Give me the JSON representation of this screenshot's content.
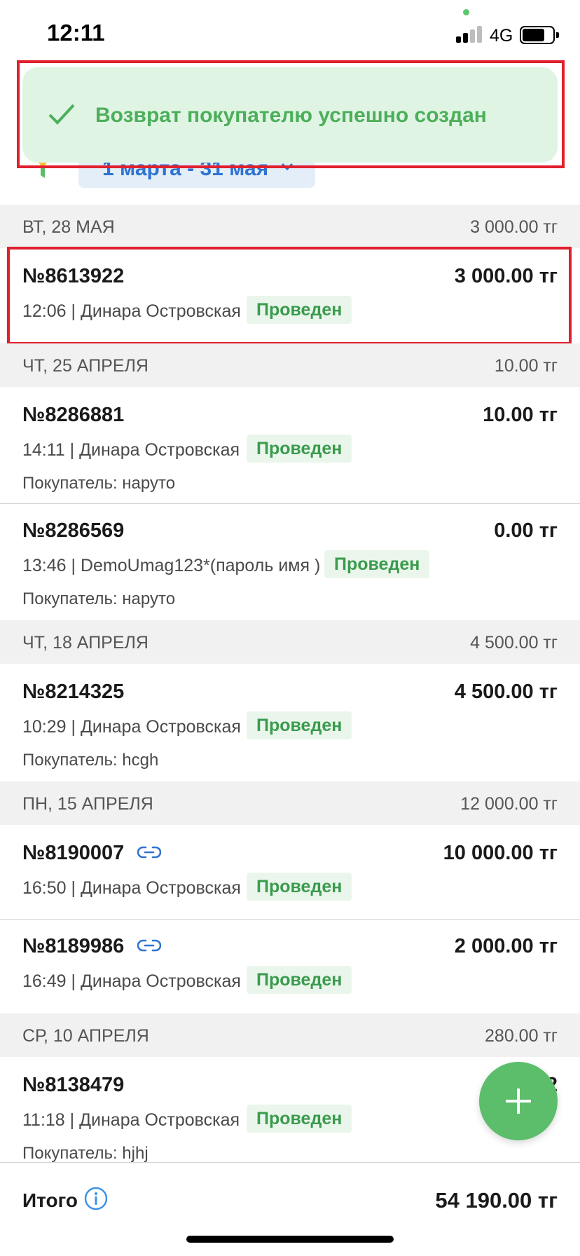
{
  "status_bar": {
    "time": "12:11",
    "network": "4G"
  },
  "toast": {
    "message": "Возврат покупателю успешно создан"
  },
  "filter": {
    "date_range": "1 марта - 31 мая"
  },
  "sections": [
    {
      "day": "ВТ, 28 МАЯ",
      "sum": "3 000.00 тг",
      "records": [
        {
          "number": "№8613922",
          "amount": "3 000.00 тг",
          "meta": "12:06 | Динара Островская",
          "status": "Проведен"
        }
      ]
    },
    {
      "day": "ЧТ, 25 АПРЕЛЯ",
      "sum": "10.00 тг",
      "records": [
        {
          "number": "№8286881",
          "amount": "10.00 тг",
          "meta": "14:11 | Динара Островская",
          "status": "Проведен",
          "buyer": "Покупатель: наруто"
        },
        {
          "number": "№8286569",
          "amount": "0.00 тг",
          "meta": "13:46 | DemoUmag123*(пароль имя )",
          "status": "Проведен",
          "buyer": "Покупатель: наруто"
        }
      ]
    },
    {
      "day": "ЧТ, 18 АПРЕЛЯ",
      "sum": "4 500.00 тг",
      "records": [
        {
          "number": "№8214325",
          "amount": "4 500.00 тг",
          "meta": "10:29 | Динара Островская",
          "status": "Проведен",
          "buyer": "Покупатель: hcgh"
        }
      ]
    },
    {
      "day": "ПН, 15 АПРЕЛЯ",
      "sum": "12 000.00 тг",
      "records": [
        {
          "number": "№8190007",
          "amount": "10 000.00 тг",
          "meta": "16:50 | Динара Островская",
          "status": "Проведен",
          "icon": "link-icon"
        },
        {
          "number": "№8189986",
          "amount": "2 000.00 тг",
          "meta": "16:49 | Динара Островская",
          "status": "Проведен",
          "icon": "link-icon"
        }
      ]
    },
    {
      "day": "СР, 10 АПРЕЛЯ",
      "sum": "280.00 тг",
      "records": [
        {
          "number": "№8138479",
          "amount": "2",
          "meta": "11:18 | Динара Островская",
          "status": "Проведен",
          "buyer": "Покупатель: hjhj"
        }
      ]
    }
  ],
  "footer": {
    "total_label": "Итого",
    "total": "54 190.00 тг"
  },
  "colors": {
    "accent_green": "#5cbd6a",
    "status_green": "#3a9b4d",
    "link_blue": "#2f74d0",
    "highlight_red": "#e0202c"
  }
}
